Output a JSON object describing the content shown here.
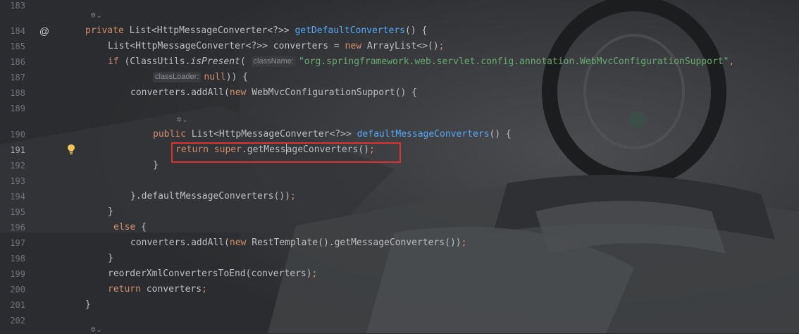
{
  "gutter": {
    "lines": [
      "183",
      "184",
      "185",
      "186",
      "187",
      "188",
      "189",
      "190",
      "191",
      "192",
      "193",
      "194",
      "195",
      "196",
      "197",
      "198",
      "199",
      "200",
      "201",
      "202"
    ],
    "current_line": "191"
  },
  "icons": {
    "override_marker": "at-sign-icon",
    "intention_bulb": "lightbulb-icon",
    "code_lens": "ai-lens-icon"
  },
  "code": {
    "l184": {
      "kw": "private",
      "type": "List<HttpMessageConverter<?>> ",
      "fn": "getDefaultConverters",
      "rest": "() {"
    },
    "l185": {
      "a": "List<HttpMessageConverter<?>> converters = ",
      "kw": "new",
      "b": " ArrayList<>()",
      "semi": ";"
    },
    "l186": {
      "kw": "if",
      "a": " (ClassUtils.",
      "fn": "isPresent",
      "b": "( ",
      "hint": "className:",
      "str": "\"org.springframework.web.servlet.config.annotation.WebMvcConfigurationSupport\"",
      "comma": ","
    },
    "l187": {
      "hint": "classLoader:",
      "kw": "null",
      "rest": ")) {"
    },
    "l188": {
      "a": "converters.addAll(",
      "kw": "new",
      "b": " WebMvcConfigurationSupport() {"
    },
    "l190": {
      "kw": "public",
      "type": " List<HttpMessageConverter<?>> ",
      "fn": "defaultMessageConverters",
      "rest": "() {"
    },
    "l191": {
      "kw": "return",
      "kw2": "super",
      "dot": ".",
      "fn_a": "getMess",
      "fn_b": "ageConverters",
      "rest": "()",
      "semi": ";"
    },
    "l192": "}",
    "l194": {
      "a": "}.defaultMessageConverters())",
      "semi": ";"
    },
    "l195": "}",
    "l196": {
      "kw": "else",
      "rest": " {"
    },
    "l197": {
      "a": "converters.addAll(",
      "kw": "new",
      "b": " RestTemplate().getMessageConverters())",
      "semi": ";"
    },
    "l198": "}",
    "l199": {
      "a": "reorderXmlConvertersToEnd(converters)",
      "semi": ";"
    },
    "l200": {
      "kw": "return",
      "a": " converters",
      "semi": ";"
    },
    "l201": "}"
  },
  "colors": {
    "keyword": "#cf8e6d",
    "function": "#56a8f5",
    "string": "#6aab73",
    "text": "#bcbec4",
    "highlight_box": "#e03030"
  }
}
